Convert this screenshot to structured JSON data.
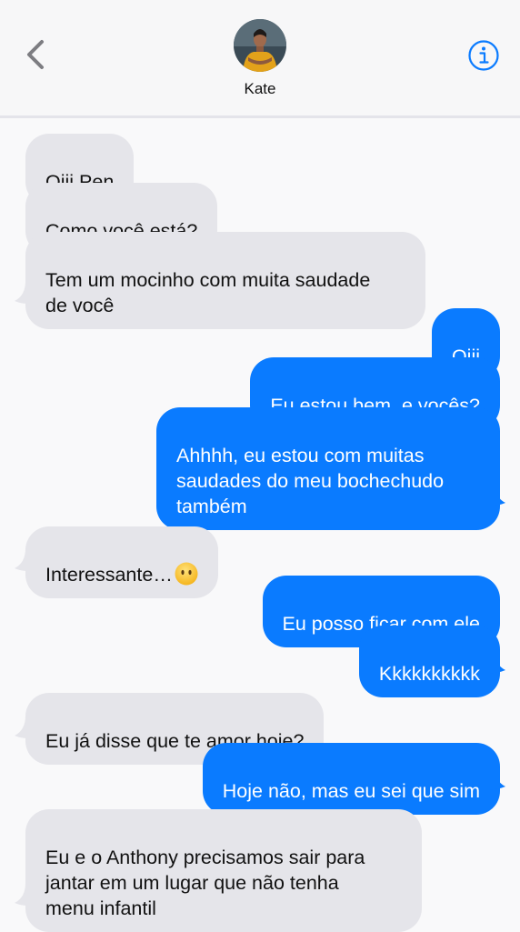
{
  "header": {
    "contact_name": "Kate",
    "back_icon": "chevron-left-icon",
    "info_icon": "info-circle-icon",
    "accent_color": "#0a7bff"
  },
  "messages": [
    {
      "from": "them",
      "text": "Oiii Pen"
    },
    {
      "from": "them",
      "text": "Como você está?"
    },
    {
      "from": "them",
      "text": "Tem um mocinho com muita saudade\nde você"
    },
    {
      "from": "me",
      "text": "Oiii"
    },
    {
      "from": "me",
      "text": "Eu estou bem, e vocês?"
    },
    {
      "from": "me",
      "text": "Ahhhh, eu estou com muitas\nsaudades do meu bochechudo\ntambém"
    },
    {
      "from": "them",
      "text": "Interessante…",
      "emoji": "face-without-mouth"
    },
    {
      "from": "me",
      "text": "Eu posso ficar com ele"
    },
    {
      "from": "me",
      "text": "Kkkkkkkkkk"
    },
    {
      "from": "them",
      "text": "Eu já disse que te amor hoje?"
    },
    {
      "from": "me",
      "text": "Hoje não, mas eu sei que sim"
    },
    {
      "from": "them",
      "text": "Eu e o Anthony precisamos sair para\njantar em um lugar que não tenha\nmenu infantil"
    }
  ]
}
